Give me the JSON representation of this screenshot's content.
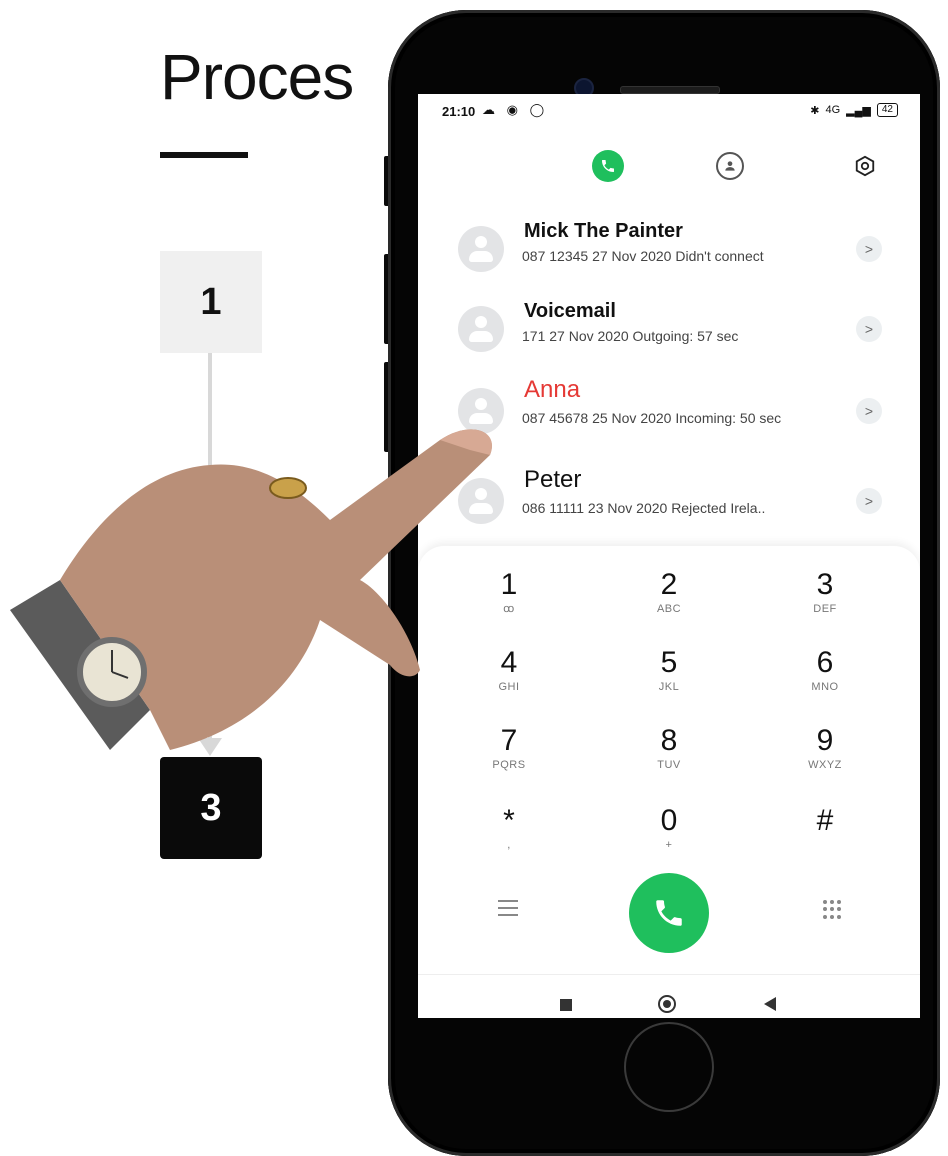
{
  "slide": {
    "title": "Proces",
    "steps": [
      "1",
      "3"
    ]
  },
  "status_bar": {
    "time": "21:10",
    "left_icons": "☁ ◉ ◯",
    "network": "4G",
    "battery": "42"
  },
  "tabs": [
    {
      "name": "phone",
      "active": true
    },
    {
      "name": "contacts",
      "active": false
    },
    {
      "name": "settings",
      "active": false
    }
  ],
  "calls": [
    {
      "name": "Mick The Painter",
      "detail": "087 12345   27 Nov 2020 Didn't connect"
    },
    {
      "name": "Voicemail",
      "detail": "171  27 Nov 2020 Outgoing: 57 sec"
    },
    {
      "name": "Anna",
      "detail": "087 45678  25 Nov 2020 Incoming: 50 sec",
      "color": "#e53935"
    },
    {
      "name": "Peter",
      "detail": "086 11111    23 Nov 2020 Rejected  Irela.."
    }
  ],
  "keypad": [
    {
      "digit": "1",
      "letters": "ꝏ"
    },
    {
      "digit": "2",
      "letters": "ABC"
    },
    {
      "digit": "3",
      "letters": "DEF"
    },
    {
      "digit": "4",
      "letters": "GHI"
    },
    {
      "digit": "5",
      "letters": "JKL"
    },
    {
      "digit": "6",
      "letters": "MNO"
    },
    {
      "digit": "7",
      "letters": "PQRS"
    },
    {
      "digit": "8",
      "letters": "TUV"
    },
    {
      "digit": "9",
      "letters": "WXYZ"
    },
    {
      "digit": "*",
      "letters": ","
    },
    {
      "digit": "0",
      "letters": "+"
    },
    {
      "digit": "#",
      "letters": ""
    }
  ],
  "colors": {
    "accent_green": "#1fbf5d",
    "missed_red": "#e53935"
  }
}
